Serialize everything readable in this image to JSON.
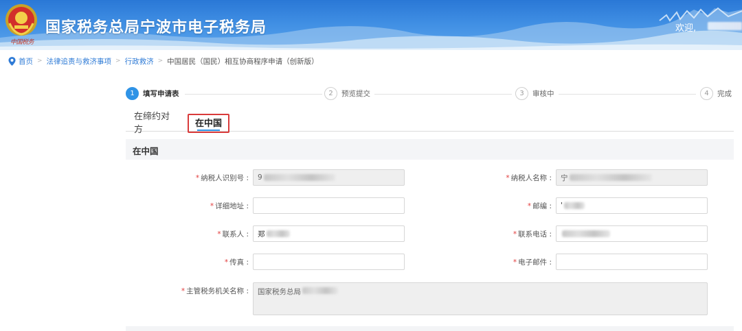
{
  "header": {
    "title": "国家税务总局宁波市电子税务局",
    "welcome": "欢迎,",
    "emblem_caption": "中国税务"
  },
  "breadcrumb": {
    "items": [
      "首页",
      "法律追责与救济事项",
      "行政救济"
    ],
    "current": "中国居民（国民）相互协商程序申请（创新版）"
  },
  "steps": [
    {
      "num": "1",
      "label": "填写申请表",
      "active": true
    },
    {
      "num": "2",
      "label": "预览提交",
      "active": false
    },
    {
      "num": "3",
      "label": "审核中",
      "active": false
    },
    {
      "num": "4",
      "label": "完成",
      "active": false
    }
  ],
  "tabs": [
    {
      "label": "在缔约对方",
      "selected": false
    },
    {
      "label": "在中国",
      "selected": true
    }
  ],
  "section": {
    "title": "在中国"
  },
  "form": {
    "taxpayer_id": {
      "label": "纳税人识别号 :",
      "required": "*",
      "value": "9"
    },
    "taxpayer_name": {
      "label": "纳税人名称 :",
      "required": "*",
      "value": "宁"
    },
    "address": {
      "label": "详细地址 :",
      "required": "*",
      "value": ""
    },
    "postcode": {
      "label": "邮编 :",
      "required": "*",
      "value": "'"
    },
    "contact": {
      "label": "联系人 :",
      "required": "*",
      "value": "郑"
    },
    "phone": {
      "label": "联系电话 :",
      "required": "*",
      "value": ""
    },
    "fax": {
      "label": "传真 :",
      "required": "*",
      "value": ""
    },
    "email": {
      "label": "电子邮件 :",
      "required": "*",
      "value": ""
    },
    "tax_authority": {
      "label": "主管税务机关名称 :",
      "required": "*",
      "value": "国家税务总局"
    }
  },
  "colors": {
    "brand_blue": "#2f93e6",
    "link_blue": "#2f7bd6",
    "required_red": "#e23b3b",
    "highlight_red": "#d93a3a"
  },
  "icons": {
    "breadcrumb": "location-pin-icon",
    "logo": "tax-emblem-icon"
  }
}
